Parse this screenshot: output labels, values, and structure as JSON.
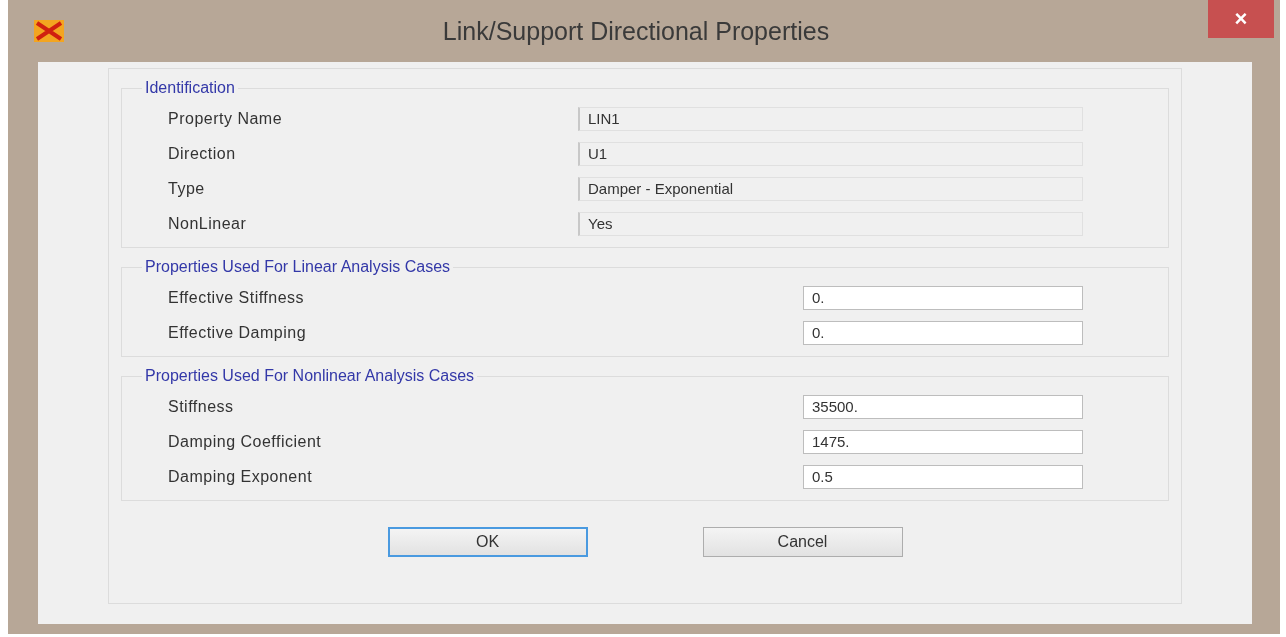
{
  "window": {
    "title": "Link/Support Directional Properties",
    "close": "×"
  },
  "groups": [
    {
      "title": "Identification",
      "kind": "readonly",
      "fields": [
        {
          "label": "Property Name",
          "value": "LIN1"
        },
        {
          "label": "Direction",
          "value": "U1"
        },
        {
          "label": "Type",
          "value": "Damper - Exponential"
        },
        {
          "label": "NonLinear",
          "value": "Yes"
        }
      ]
    },
    {
      "title": "Properties Used For Linear Analysis Cases",
      "kind": "editable",
      "fields": [
        {
          "label": "Effective Stiffness",
          "value": "0."
        },
        {
          "label": "Effective Damping",
          "value": "0."
        }
      ]
    },
    {
      "title": "Properties Used For Nonlinear Analysis Cases",
      "kind": "editable",
      "fields": [
        {
          "label": "Stiffness",
          "value": "35500."
        },
        {
          "label": "Damping Coefficient",
          "value": "1475."
        },
        {
          "label": "Damping Exponent",
          "value": "0.5"
        }
      ]
    }
  ],
  "buttons": [
    {
      "label": "OK",
      "selected": true
    },
    {
      "label": "Cancel",
      "selected": false
    }
  ]
}
